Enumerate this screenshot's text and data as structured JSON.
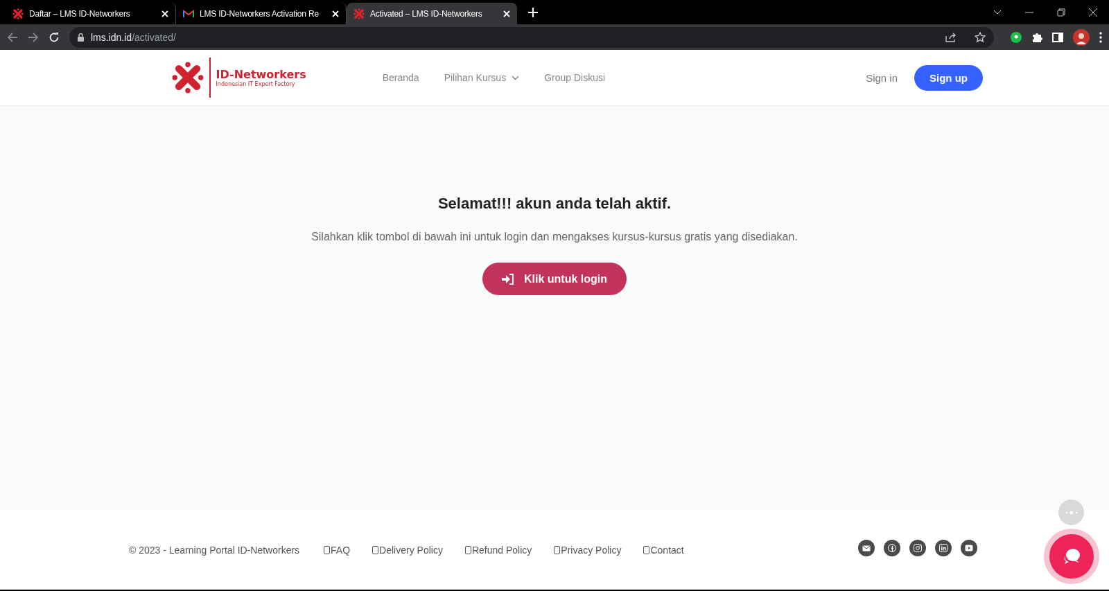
{
  "browser": {
    "tabs": [
      {
        "title": "Daftar – LMS ID-Networkers",
        "kind": "site",
        "selected": false
      },
      {
        "title": "LMS ID-Networkers Activation Re",
        "kind": "mail",
        "selected": false
      },
      {
        "title": "Activated – LMS ID-Networkers",
        "kind": "site",
        "selected": true
      }
    ],
    "url": {
      "host": "lms.idn.id",
      "path": "/activated/"
    }
  },
  "header": {
    "logo": {
      "name": "ID-Networkers",
      "tagline": "Indonesian IT Expert Factory"
    },
    "nav": [
      {
        "label": "Beranda",
        "dropdown": false
      },
      {
        "label": "Pilihan Kursus",
        "dropdown": true
      },
      {
        "label": "Group Diskusi",
        "dropdown": false
      }
    ],
    "sign_in": "Sign in",
    "sign_up": "Sign up"
  },
  "main": {
    "title": "Selamat!!! akun anda telah aktif.",
    "message": "Silahkan klik tombol di bawah ini untuk login dan mengakses kursus-kursus gratis yang disediakan.",
    "button": "Klik untuk login"
  },
  "footer": {
    "copyright": "© 2023 - Learning Portal ID-Networkers",
    "links": [
      "FAQ",
      "Delivery Policy",
      "Refund Policy",
      "Privacy Policy",
      "Contact"
    ],
    "social": [
      {
        "kind": "email"
      },
      {
        "kind": "facebook"
      },
      {
        "kind": "instagram"
      },
      {
        "kind": "linkedin"
      },
      {
        "kind": "youtube"
      }
    ]
  }
}
